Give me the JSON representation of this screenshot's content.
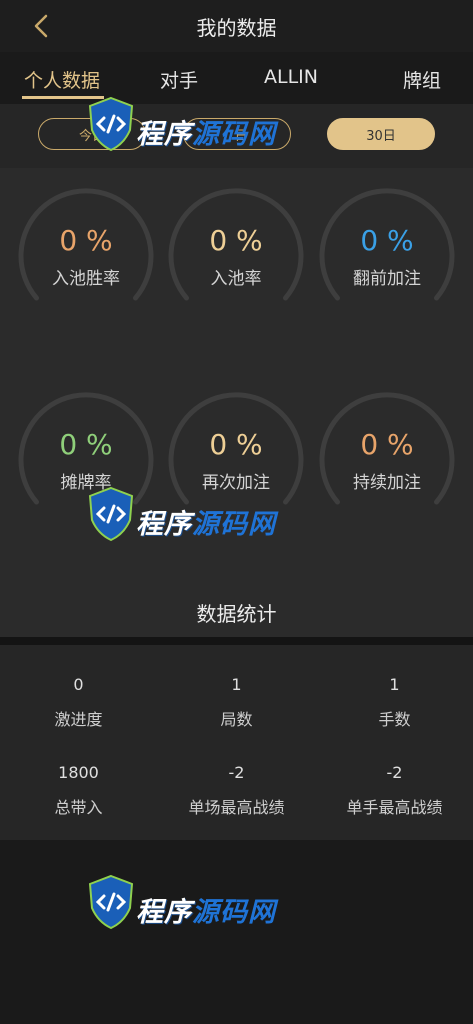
{
  "header": {
    "title": "我的数据"
  },
  "tabs": [
    {
      "label": "个人数据",
      "active": true
    },
    {
      "label": "对手",
      "active": false
    },
    {
      "label": "ALLIN",
      "active": false
    },
    {
      "label": "牌组",
      "active": false
    }
  ],
  "ranges": [
    {
      "label": "今日",
      "active": false
    },
    {
      "label": "7日",
      "active": false
    },
    {
      "label": "30日",
      "active": true
    }
  ],
  "gauges": [
    {
      "value": "0 %",
      "label": "入池胜率",
      "color": "#e8a46a"
    },
    {
      "value": "0 %",
      "label": "入池率",
      "color": "#eecf96"
    },
    {
      "value": "0 %",
      "label": "翻前加注",
      "color": "#3aa0e6"
    },
    {
      "value": "0 %",
      "label": "摊牌率",
      "color": "#8fcf7a"
    },
    {
      "value": "0 %",
      "label": "再次加注",
      "color": "#eecf96"
    },
    {
      "value": "0 %",
      "label": "持续加注",
      "color": "#e8a46a"
    }
  ],
  "stats_title": "数据统计",
  "stats": [
    {
      "value": "0",
      "label": "激进度"
    },
    {
      "value": "1",
      "label": "局数"
    },
    {
      "value": "1",
      "label": "手数"
    },
    {
      "value": "1800",
      "label": "总带入"
    },
    {
      "value": "-2",
      "label": "单场最高战绩"
    },
    {
      "value": "-2",
      "label": "单手最高战绩"
    }
  ],
  "watermark": {
    "text_a": "程序",
    "text_b": "源码网"
  },
  "colors": {
    "accent": "#e2c48a",
    "background": "#262626",
    "panel": "#2b2b2b"
  }
}
